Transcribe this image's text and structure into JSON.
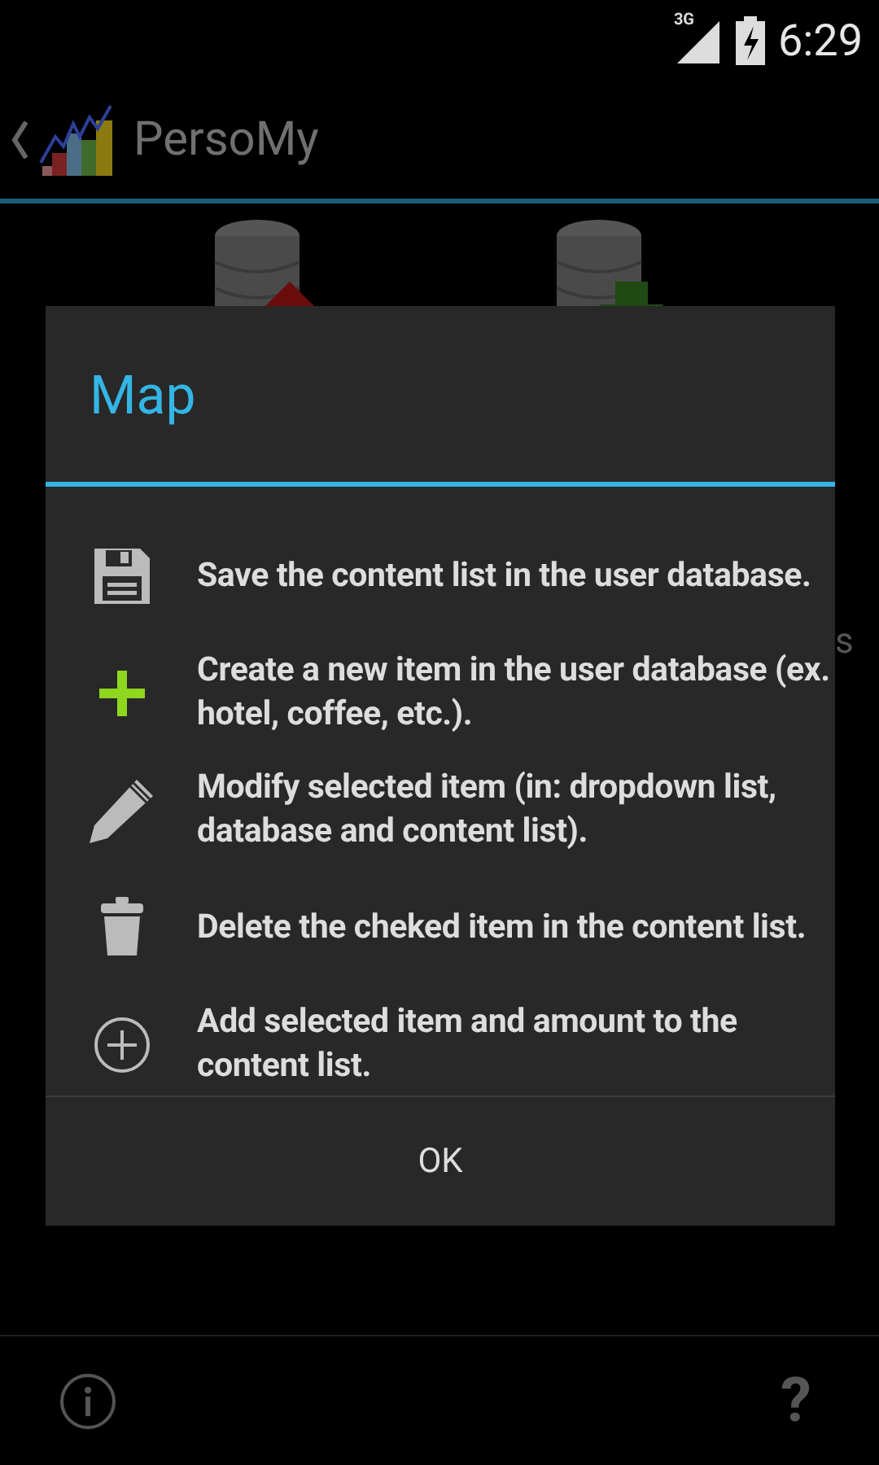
{
  "status_bar": {
    "network": "3G",
    "time": "6:29"
  },
  "action_bar": {
    "title": "PersoMy"
  },
  "background_fragment": "s",
  "dialog": {
    "title": "Map",
    "items": [
      {
        "kind": "save",
        "text": "Save the content list in the user database."
      },
      {
        "kind": "create",
        "text": "Create a new item in the user database (ex. hotel, coffee, etc.)."
      },
      {
        "kind": "modify",
        "text": "Modify selected item (in: dropdown list, database and content list)."
      },
      {
        "kind": "delete",
        "text": "Delete the cheked item in the content list."
      },
      {
        "kind": "add",
        "text": "Add selected item and amount to the content list."
      }
    ],
    "button": "OK"
  },
  "bottom_bar": {
    "help": "?"
  }
}
